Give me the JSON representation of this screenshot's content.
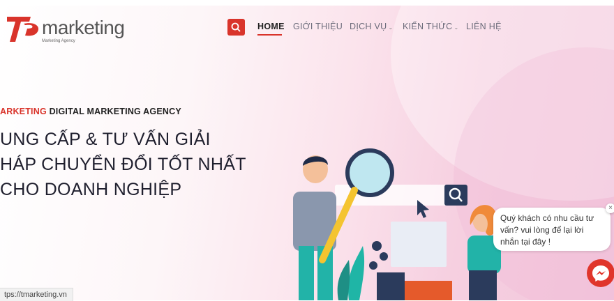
{
  "header": {
    "logo_text": "marketing",
    "logo_subtext": "Marketing Agency",
    "nav": [
      {
        "label": "HOME",
        "has_dropdown": false,
        "active": true
      },
      {
        "label": "GIỚI THIỆU",
        "has_dropdown": false,
        "active": false
      },
      {
        "label": "DỊCH VỤ",
        "has_dropdown": true,
        "active": false
      },
      {
        "label": "KIẾN THỨC",
        "has_dropdown": true,
        "active": false
      },
      {
        "label": "LIÊN HỆ",
        "has_dropdown": false,
        "active": false
      }
    ],
    "search_icon": "search-icon"
  },
  "hero": {
    "tagline_red": "ARKETING",
    "tagline_rest": " DIGITAL MARKETING AGENCY",
    "headline_lines": [
      "UNG CẤP & TƯ VẤN GIẢI",
      "HÁP CHUYỂN ĐỔI TỐT NHẤT",
      "CHO DOANH NGHIỆP"
    ]
  },
  "chat": {
    "lines": [
      "Quý khách có nhu cầu tư",
      "vấn? vui lòng để lại lời",
      "nhắn tại đây !"
    ],
    "close_symbol": "×",
    "messenger_icon": "messenger-icon"
  },
  "status_url": "tps://tmarketing.vn",
  "colors": {
    "brand_red": "#d9342b",
    "text_dark": "#1f1f2e",
    "nav_gray": "#6b6b7a"
  }
}
